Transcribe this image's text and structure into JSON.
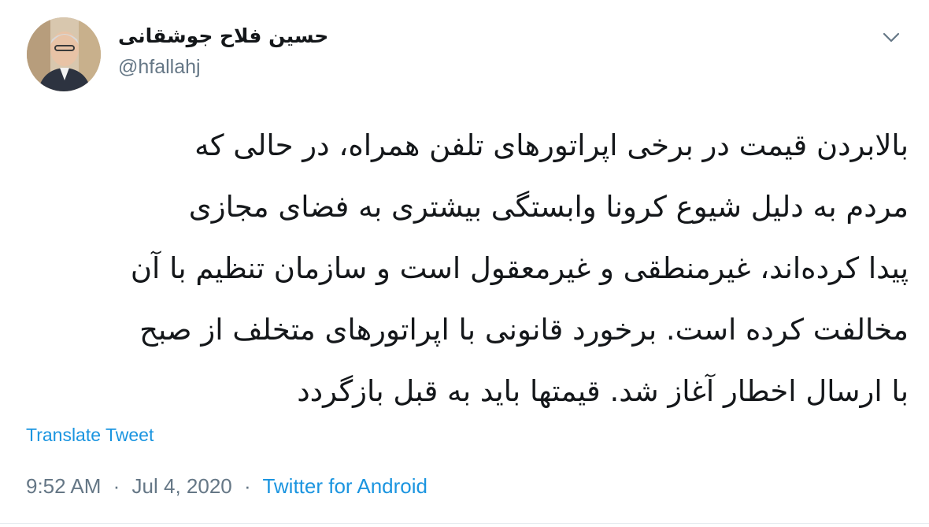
{
  "author": {
    "display_name": "حسین فلاح جوشقانی",
    "handle": "@hfallahj",
    "avatar_icon": "profile-photo"
  },
  "menu": {
    "icon": "chevron-down-icon"
  },
  "tweet": {
    "lines": [
      "بالابردن قیمت در برخی اپراتورهای تلفن همراه، در حالی که",
      "مردم به دلیل شیوع کرونا وابستگی بیشتری به فضای مجازی",
      "پیدا کرده‌اند، غیرمنطقی و غیرمعقول است و سازمان تنظیم با آن",
      "مخالفت کرده است. برخورد قانونی با اپراتورهای متخلف از صبح",
      "با ارسال اخطار آغاز شد. قیمتها باید به قبل بازگردد"
    ],
    "translate_label": "Translate Tweet"
  },
  "meta": {
    "time": "9:52 AM",
    "separator": "·",
    "date": "Jul 4, 2020",
    "source": "Twitter for Android"
  },
  "colors": {
    "text": "#14171a",
    "secondary": "#657786",
    "link": "#1b95e0",
    "divider": "#e6ecf0"
  }
}
